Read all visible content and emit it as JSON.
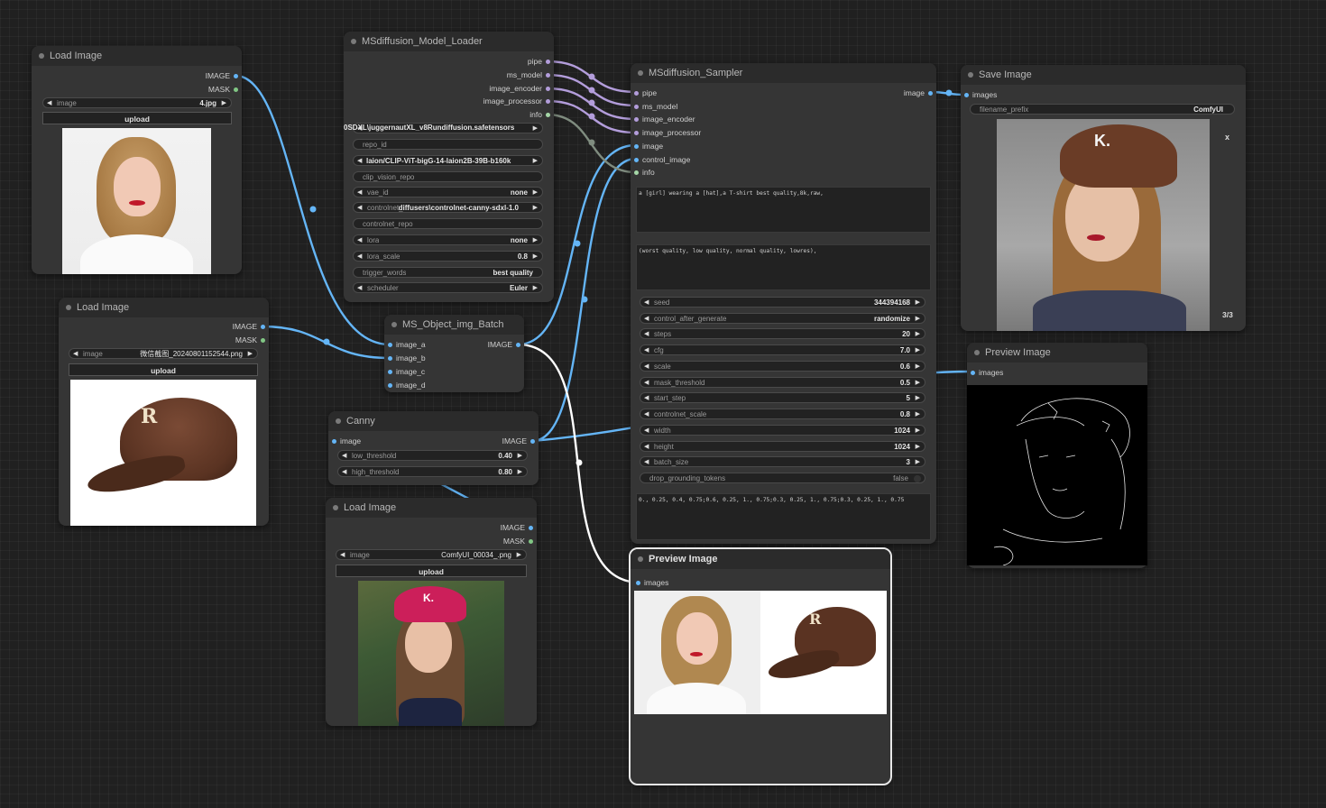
{
  "colors": {
    "image_wire": "#64b5f6",
    "pipe_wire": "#b39ddb",
    "info_wire": "#7f8c7f",
    "image_dot": "#64b5f6",
    "mask_dot": "#81c784",
    "pipe_dot": "#b39ddb",
    "info_dot": "#a5d6a7"
  },
  "load1": {
    "title": "Load Image",
    "out_image": "IMAGE",
    "out_mask": "MASK",
    "image_label": "image",
    "image_value": "4.jpg",
    "upload": "upload"
  },
  "load2": {
    "title": "Load Image",
    "out_image": "IMAGE",
    "out_mask": "MASK",
    "image_label": "image",
    "image_value": "微信截图_20240801152544.png",
    "upload": "upload"
  },
  "load3": {
    "title": "Load Image",
    "out_image": "IMAGE",
    "out_mask": "MASK",
    "image_label": "image",
    "image_value": "ComfyUI_00034_.png",
    "upload": "upload"
  },
  "loader": {
    "title": "MSdiffusion_Model_Loader",
    "outputs": [
      "pipe",
      "ms_model",
      "image_encoder",
      "image_processor",
      "info"
    ],
    "ckpt_overlap": "0SDXL\\juggernautXL_v8Rundiffusion.safetensors",
    "repo_id": "repo_id",
    "clip_overlap": "laion/CLIP-ViT-bigG-14-laion2B-39B-b160k",
    "clip_vision_repo": "clip_vision_repo",
    "vae_id": {
      "label": "vae_id",
      "value": "none"
    },
    "controlnet": {
      "label": "controlnet_...",
      "value": "diffusers\\controlnet-canny-sdxl-1.0"
    },
    "controlnet_repo": "controlnet_repo",
    "lora": {
      "label": "lora",
      "value": "none"
    },
    "lora_scale": {
      "label": "lora_scale",
      "value": "0.8"
    },
    "trigger_words": {
      "label": "trigger_words",
      "value": "best quality"
    },
    "scheduler": {
      "label": "scheduler",
      "value": "Euler"
    }
  },
  "batch": {
    "title": "MS_Object_img_Batch",
    "inputs": [
      "image_a",
      "image_b",
      "image_c",
      "image_d"
    ],
    "output": "IMAGE"
  },
  "canny": {
    "title": "Canny",
    "input": "image",
    "output": "IMAGE",
    "low": {
      "label": "low_threshold",
      "value": "0.40"
    },
    "high": {
      "label": "high_threshold",
      "value": "0.80"
    }
  },
  "sampler": {
    "title": "MSdiffusion_Sampler",
    "inputs": [
      "pipe",
      "ms_model",
      "image_encoder",
      "image_processor",
      "image",
      "control_image",
      "info"
    ],
    "output": "image",
    "prompt": "a [girl] wearing a [hat],a T-shirt best quality,8k,raw,",
    "negative": "(worst quality, low quality, normal quality, lowres),",
    "widgets": [
      {
        "label": "seed",
        "value": "344394168"
      },
      {
        "label": "control_after_generate",
        "value": "randomize"
      },
      {
        "label": "steps",
        "value": "20"
      },
      {
        "label": "cfg",
        "value": "7.0"
      },
      {
        "label": "scale",
        "value": "0.6"
      },
      {
        "label": "mask_threshold",
        "value": "0.5"
      },
      {
        "label": "start_step",
        "value": "5"
      },
      {
        "label": "controlnet_scale",
        "value": "0.8"
      },
      {
        "label": "width",
        "value": "1024"
      },
      {
        "label": "height",
        "value": "1024"
      },
      {
        "label": "batch_size",
        "value": "3"
      }
    ],
    "drop_grounding": {
      "label": "drop_grounding_tokens",
      "value": "false"
    },
    "location": "0., 0.25, 0.4, 0.75;0.6, 0.25, 1., 0.75;0.3, 0.25, 1., 0.75;0.3, 0.25, 1., 0.75"
  },
  "save": {
    "title": "Save Image",
    "input": "images",
    "prefix": {
      "label": "filename_prefix",
      "value": "ComfyUI"
    },
    "close": "x",
    "counter": "3/3"
  },
  "preview1": {
    "title": "Preview Image",
    "input": "images"
  },
  "preview2": {
    "title": "Preview Image",
    "input": "images"
  }
}
